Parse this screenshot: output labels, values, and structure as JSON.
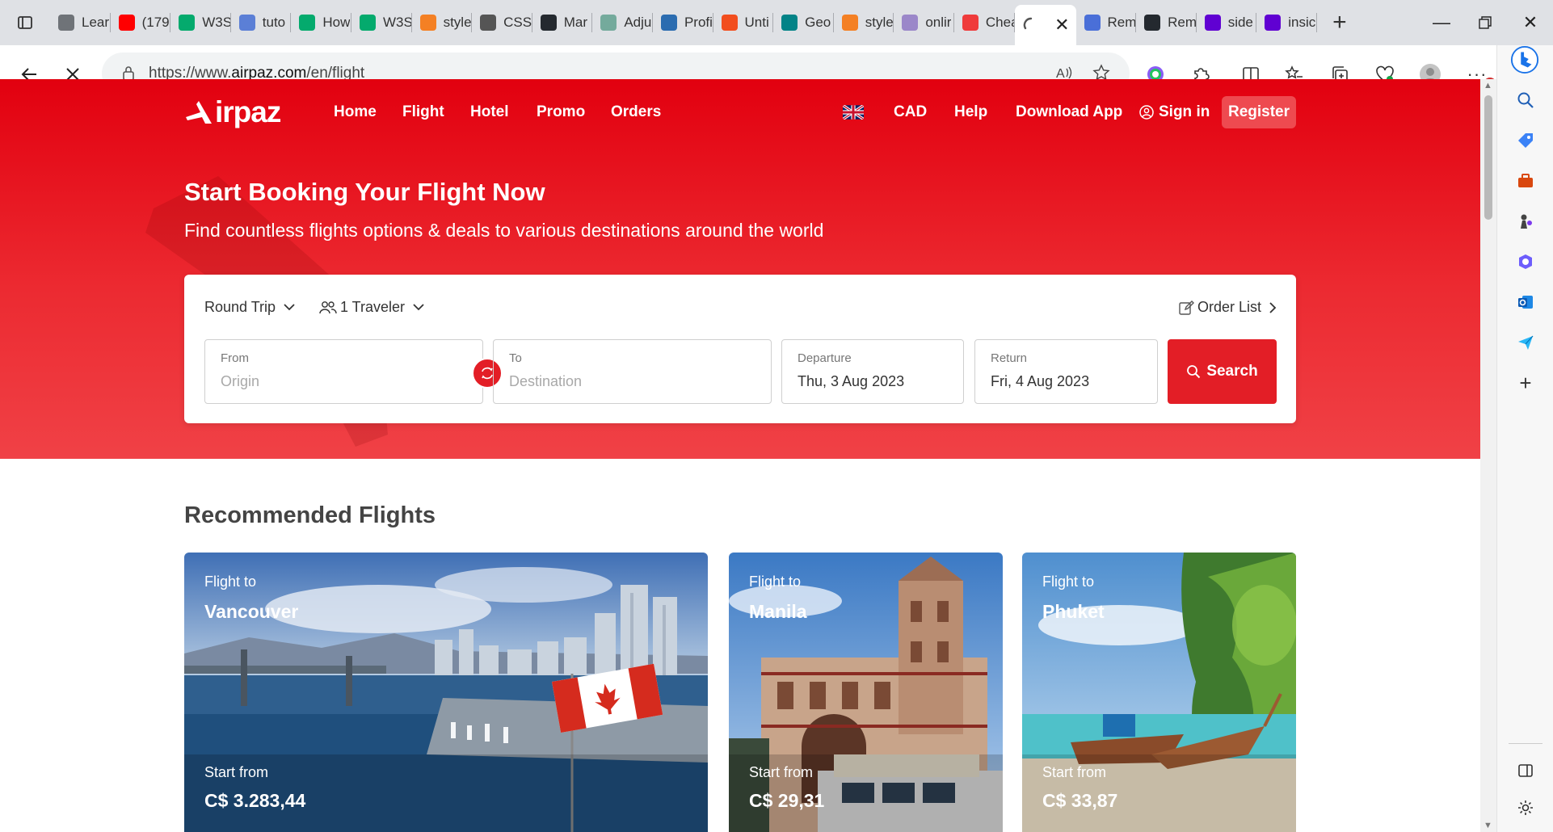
{
  "browser": {
    "tabs": [
      {
        "label": "Lear",
        "icon": "learn-icon",
        "color": "#6f7378"
      },
      {
        "label": "(179",
        "icon": "youtube-icon",
        "color": "#ff0000"
      },
      {
        "label": "W3S",
        "icon": "w3schools-icon",
        "color": "#04aa6d"
      },
      {
        "label": "tuto",
        "icon": "tutorial-icon",
        "color": "#5b7fd6"
      },
      {
        "label": "How",
        "icon": "w3schools-icon",
        "color": "#04aa6d"
      },
      {
        "label": "W3S",
        "icon": "w3schools-icon",
        "color": "#04aa6d"
      },
      {
        "label": "style",
        "icon": "stackoverflow-icon",
        "color": "#f48024"
      },
      {
        "label": "CSS",
        "icon": "document-icon",
        "color": "#555555"
      },
      {
        "label": "Mar",
        "icon": "github-icon",
        "color": "#24292f"
      },
      {
        "label": "Adju",
        "icon": "openai-icon",
        "color": "#74aa9c"
      },
      {
        "label": "Profi",
        "icon": "chart-icon",
        "color": "#2b6cb0"
      },
      {
        "label": "Unti",
        "icon": "figma-icon",
        "color": "#f24e1e"
      },
      {
        "label": "Geo",
        "icon": "sharepoint-icon",
        "color": "#038387"
      },
      {
        "label": "style",
        "icon": "stackoverflow-icon",
        "color": "#f48024"
      },
      {
        "label": "onlir",
        "icon": "yahoo-icon",
        "color": "#9b87c9"
      },
      {
        "label": "Chea",
        "icon": "airpaz-icon",
        "color": "#ef3b3b"
      }
    ],
    "active_tab": {
      "label": "",
      "icon": "loading-icon"
    },
    "tabs_after": [
      {
        "label": "Rem",
        "icon": "doc-icon",
        "color": "#4a6fd8"
      },
      {
        "label": "Rem",
        "icon": "github-icon",
        "color": "#24292f"
      },
      {
        "label": "side",
        "icon": "yahoo-icon",
        "color": "#6001d2"
      },
      {
        "label": "insic",
        "icon": "yahoo-icon",
        "color": "#6001d2"
      }
    ],
    "url_prefix": "https://www.",
    "url_host": "airpaz.com",
    "url_path": "/en/flight",
    "notification_count": "1"
  },
  "nav": {
    "brand": "irpaz",
    "links": [
      "Home",
      "Flight",
      "Hotel",
      "Promo",
      "Orders"
    ],
    "currency": "CAD",
    "help": "Help",
    "download": "Download App",
    "signin": "Sign in",
    "register": "Register"
  },
  "hero": {
    "title": "Start Booking Your Flight Now",
    "subtitle": "Find countless flights options & deals to various destinations around the world"
  },
  "search": {
    "trip_type": "Round Trip",
    "travelers": "1 Traveler",
    "order_list": "Order List",
    "from_label": "From",
    "from_placeholder": "Origin",
    "to_label": "To",
    "to_placeholder": "Destination",
    "departure_label": "Departure",
    "departure_value": "Thu, 3 Aug 2023",
    "return_label": "Return",
    "return_value": "Fri, 4 Aug 2023",
    "button": "Search"
  },
  "recommended": {
    "title": "Recommended Flights",
    "cards": [
      {
        "flight_to": "Flight to",
        "city": "Vancouver",
        "start_from": "Start from",
        "price": "C$ 3.283,44"
      },
      {
        "flight_to": "Flight to",
        "city": "Manila",
        "start_from": "Start from",
        "price": "C$ 29,31"
      },
      {
        "flight_to": "Flight to",
        "city": "Phuket",
        "start_from": "Start from",
        "price": "C$ 33,87"
      }
    ]
  },
  "colors": {
    "brand_red": "#e31e26",
    "hero_top": "#e2000f",
    "hero_bottom": "#f04146"
  }
}
